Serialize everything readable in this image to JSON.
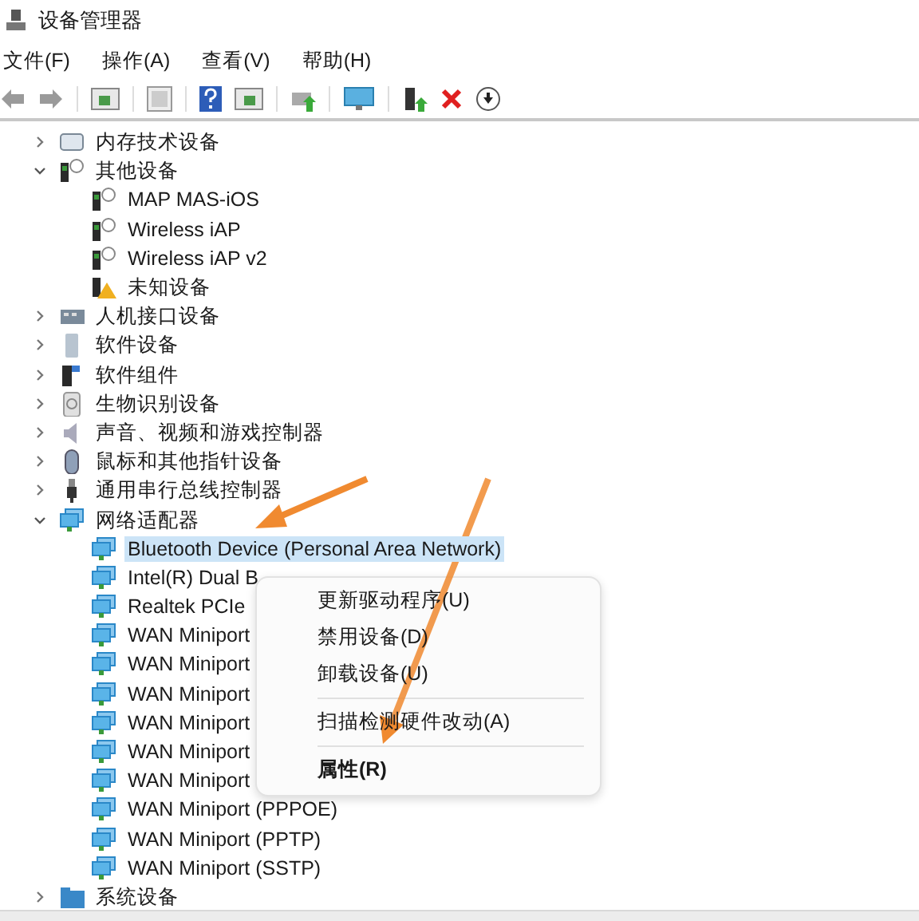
{
  "window": {
    "title": "设备管理器"
  },
  "menu_bar": [
    "文件(F)",
    "操作(A)",
    "查看(V)",
    "帮助(H)"
  ],
  "tree": [
    {
      "label": "内存技术设备",
      "kind": "memory",
      "expanded": false,
      "selected": false
    },
    {
      "label": "其他设备",
      "kind": "unknown",
      "expanded": true,
      "selected": false,
      "children": [
        {
          "label": "MAP MAS-iOS",
          "kind": "unknown",
          "selected": false
        },
        {
          "label": "Wireless iAP",
          "kind": "unknown",
          "selected": false
        },
        {
          "label": "Wireless iAP v2",
          "kind": "unknown",
          "selected": false
        },
        {
          "label": "未知设备",
          "kind": "warning",
          "selected": false
        }
      ]
    },
    {
      "label": "人机接口设备",
      "kind": "hid",
      "expanded": false,
      "selected": false
    },
    {
      "label": "软件设备",
      "kind": "software",
      "expanded": false,
      "selected": false
    },
    {
      "label": "软件组件",
      "kind": "component",
      "expanded": false,
      "selected": false
    },
    {
      "label": "生物识别设备",
      "kind": "biometric",
      "expanded": false,
      "selected": false
    },
    {
      "label": "声音、视频和游戏控制器",
      "kind": "sound",
      "expanded": false,
      "selected": false
    },
    {
      "label": "鼠标和其他指针设备",
      "kind": "mouse",
      "expanded": false,
      "selected": false
    },
    {
      "label": "通用串行总线控制器",
      "kind": "usb",
      "expanded": false,
      "selected": false
    },
    {
      "label": "网络适配器",
      "kind": "network",
      "expanded": true,
      "selected": false,
      "children": [
        {
          "label": "Bluetooth Device (Personal Area Network)",
          "kind": "network",
          "selected": true
        },
        {
          "label": "Intel(R) Dual B",
          "kind": "network",
          "selected": false
        },
        {
          "label": "Realtek PCIe",
          "kind": "network",
          "selected": false
        },
        {
          "label": "WAN Miniport",
          "kind": "network",
          "selected": false
        },
        {
          "label": "WAN Miniport",
          "kind": "network",
          "selected": false
        },
        {
          "label": "WAN Miniport",
          "kind": "network",
          "selected": false
        },
        {
          "label": "WAN Miniport",
          "kind": "network",
          "selected": false
        },
        {
          "label": "WAN Miniport",
          "kind": "network",
          "selected": false
        },
        {
          "label": "WAN Miniport",
          "kind": "network",
          "selected": false
        },
        {
          "label": "WAN Miniport (PPPOE)",
          "kind": "network",
          "selected": false
        },
        {
          "label": "WAN Miniport (PPTP)",
          "kind": "network",
          "selected": false
        },
        {
          "label": "WAN Miniport (SSTP)",
          "kind": "network",
          "selected": false
        }
      ]
    },
    {
      "label": "系统设备",
      "kind": "system",
      "expanded": false,
      "selected": false
    }
  ],
  "context_menu": [
    {
      "kind": "item",
      "label": "更新驱动程序(U)",
      "default": false
    },
    {
      "kind": "item",
      "label": "禁用设备(D)",
      "default": false
    },
    {
      "kind": "item",
      "label": "卸载设备(U)",
      "default": false
    },
    {
      "kind": "separator"
    },
    {
      "kind": "item",
      "label": "扫描检测硬件改动(A)",
      "default": false
    },
    {
      "kind": "separator"
    },
    {
      "kind": "item",
      "label": "属性(R)",
      "default": true
    }
  ]
}
